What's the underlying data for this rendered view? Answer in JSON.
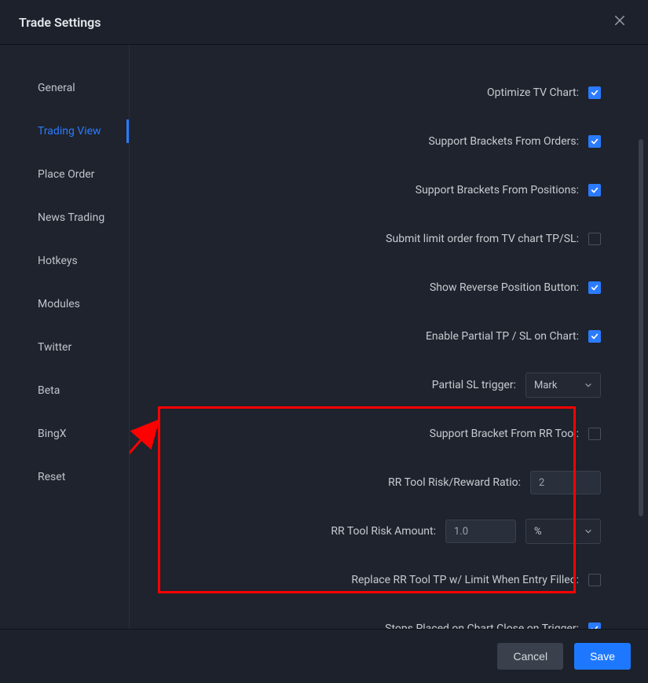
{
  "title": "Trade Settings",
  "sidebar": {
    "items": [
      {
        "label": "General"
      },
      {
        "label": "Trading View",
        "active": true
      },
      {
        "label": "Place Order"
      },
      {
        "label": "News Trading"
      },
      {
        "label": "Hotkeys"
      },
      {
        "label": "Modules"
      },
      {
        "label": "Twitter"
      },
      {
        "label": "Beta"
      },
      {
        "label": "BingX"
      },
      {
        "label": "Reset"
      }
    ]
  },
  "settings": {
    "optimize_tv_chart": {
      "label": "Optimize TV Chart:",
      "checked": true
    },
    "support_brackets_orders": {
      "label": "Support Brackets From Orders:",
      "checked": true
    },
    "support_brackets_positions": {
      "label": "Support Brackets From Positions:",
      "checked": true
    },
    "submit_limit_tpsl": {
      "label": "Submit limit order from TV chart TP/SL:",
      "checked": false
    },
    "show_reverse_position": {
      "label": "Show Reverse Position Button:",
      "checked": true
    },
    "enable_partial_tpsl": {
      "label": "Enable Partial TP / SL on Chart:",
      "checked": true
    },
    "partial_sl_trigger": {
      "label": "Partial SL trigger:",
      "value": "Mark"
    },
    "support_bracket_rr": {
      "label": "Support Bracket From RR Tool:",
      "checked": false
    },
    "rr_ratio": {
      "label": "RR Tool Risk/Reward Ratio:",
      "value": "2"
    },
    "rr_risk_amount": {
      "label": "RR Tool Risk Amount:",
      "value": "1.0",
      "unit": "%"
    },
    "replace_rr_tp": {
      "label": "Replace RR Tool TP w/ Limit When Entry Filled:",
      "checked": false
    },
    "stops_close_on_trigger": {
      "label": "Stops Placed on Chart Close on Trigger:",
      "checked": true
    }
  },
  "footer": {
    "cancel": "Cancel",
    "save": "Save"
  }
}
